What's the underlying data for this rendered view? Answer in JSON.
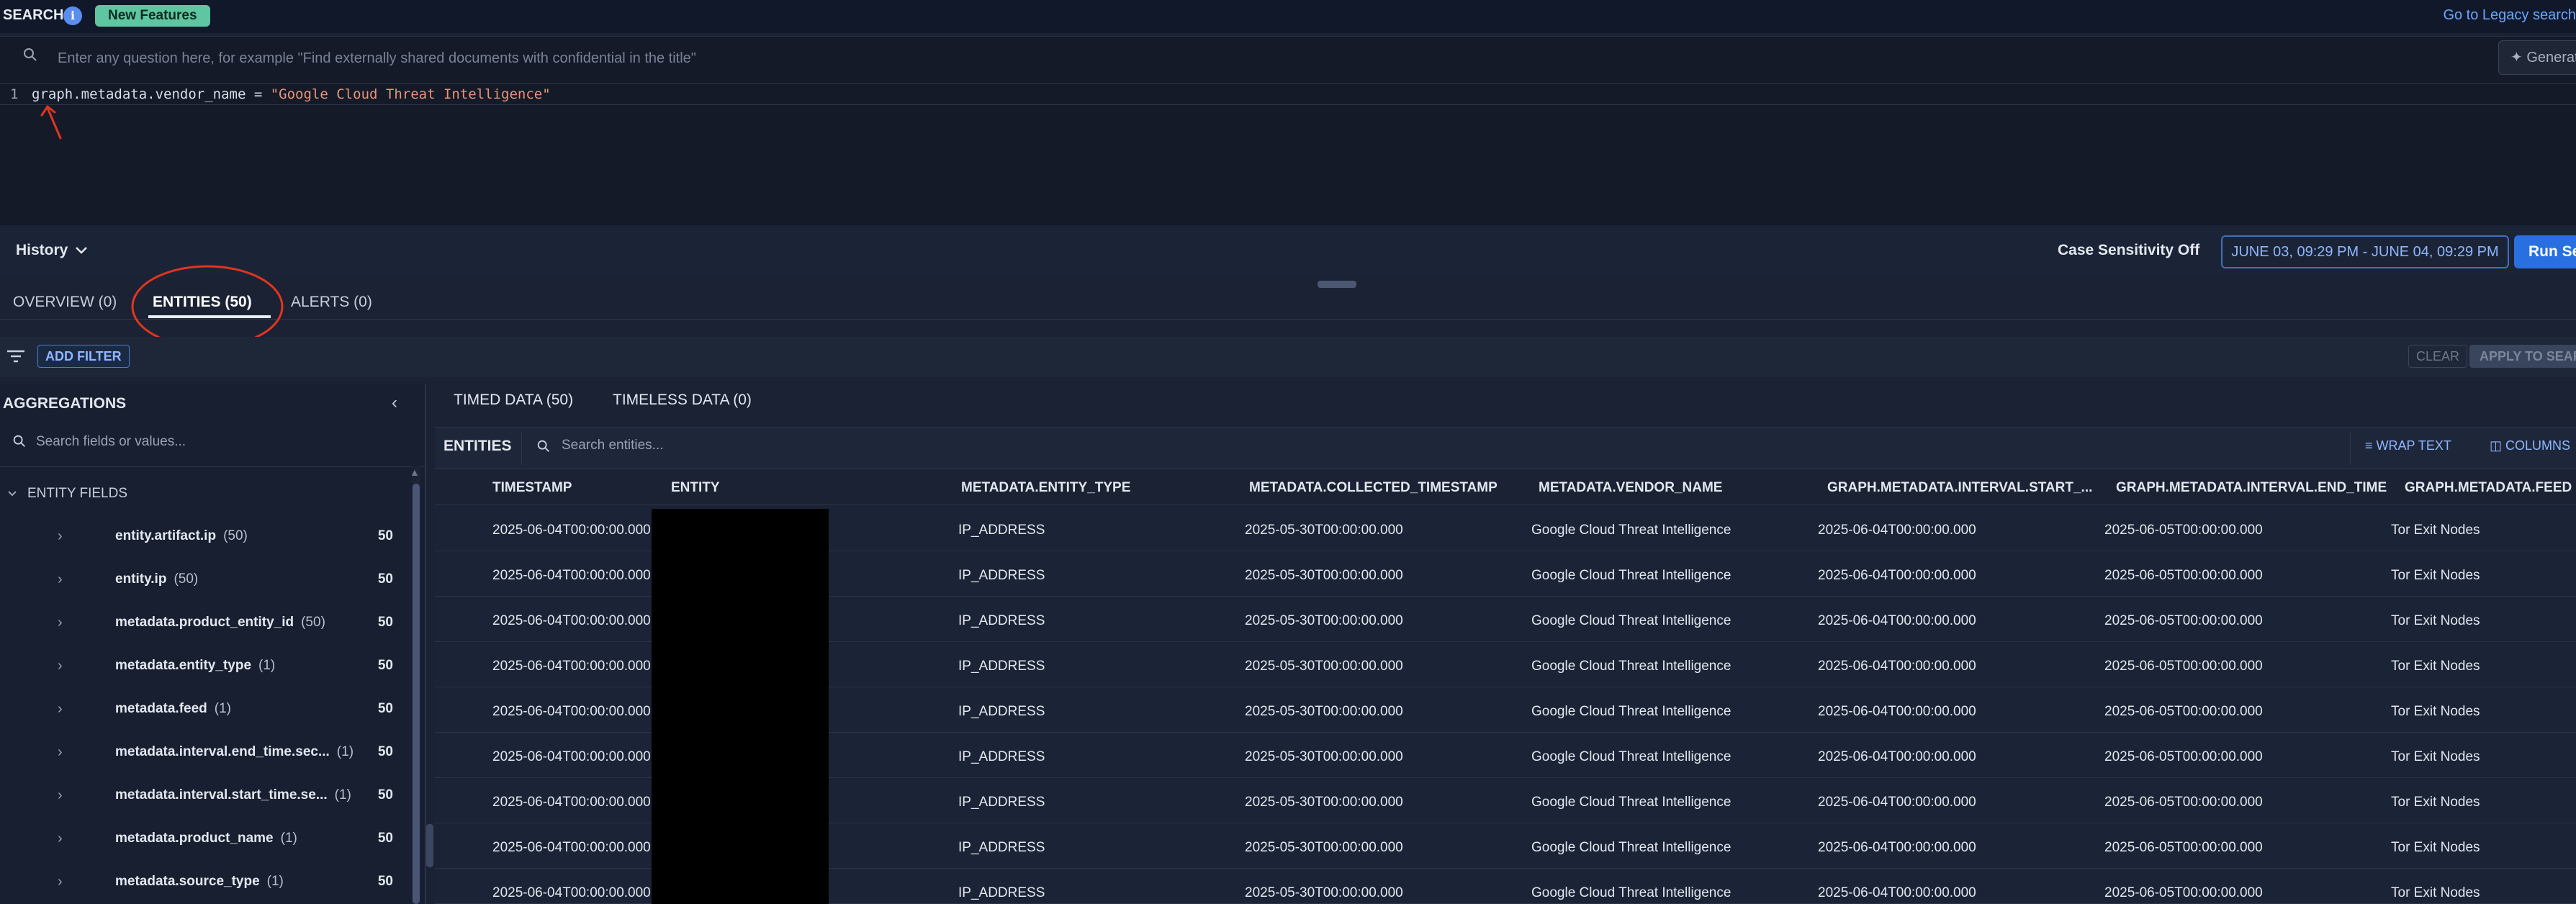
{
  "header": {
    "search_label": "SEARCH",
    "new_features": "New Features",
    "legacy_link": "Go to Legacy search"
  },
  "query": {
    "ask_placeholder": "Enter any question here, for example \"Find externally shared documents with confidential in the title\"",
    "generate_label": "Generate",
    "line_number": "1",
    "code_field": "graph.metadata.vendor_name = ",
    "code_value": "\"Google Cloud Threat Intelligence\""
  },
  "controls": {
    "history": "History",
    "case_sensitivity": "Case Sensitivity Off",
    "date_range": "JUNE 03, 09:29 PM - JUNE 04, 09:29 PM",
    "run_search": "Run Search"
  },
  "tabs": [
    {
      "label": "OVERVIEW (0)"
    },
    {
      "label": "ENTITIES (50)"
    },
    {
      "label": "ALERTS (0)"
    }
  ],
  "filters": {
    "add_filter": "ADD FILTER",
    "clear": "CLEAR",
    "apply": "APPLY TO SEARCH"
  },
  "aggregations": {
    "title": "AGGREGATIONS",
    "search_placeholder": "Search fields or values...",
    "section_label": "ENTITY FIELDS",
    "fields": [
      {
        "name": "entity.artifact.ip",
        "count": "(50)",
        "total": "50"
      },
      {
        "name": "entity.ip",
        "count": "(50)",
        "total": "50"
      },
      {
        "name": "metadata.product_entity_id",
        "count": "(50)",
        "total": "50"
      },
      {
        "name": "metadata.entity_type",
        "count": "(1)",
        "total": "50"
      },
      {
        "name": "metadata.feed",
        "count": "(1)",
        "total": "50"
      },
      {
        "name": "metadata.interval.end_time.sec...",
        "count": "(1)",
        "total": "50"
      },
      {
        "name": "metadata.interval.start_time.se...",
        "count": "(1)",
        "total": "50"
      },
      {
        "name": "metadata.product_name",
        "count": "(1)",
        "total": "50"
      },
      {
        "name": "metadata.source_type",
        "count": "(1)",
        "total": "50"
      }
    ]
  },
  "results": {
    "tabs": [
      {
        "label": "TIMED DATA (50)"
      },
      {
        "label": "TIMELESS DATA (0)"
      }
    ],
    "toolbar_label": "ENTITIES",
    "search_placeholder": "Search entities...",
    "wrap_text": "WRAP TEXT",
    "columns": "COLUMNS",
    "headers": [
      "TIMESTAMP",
      "ENTITY",
      "METADATA.ENTITY_TYPE",
      "METADATA.COLLECTED_TIMESTAMP",
      "METADATA.VENDOR_NAME",
      "GRAPH.METADATA.INTERVAL.START_...",
      "GRAPH.METADATA.INTERVAL.END_TIME",
      "GRAPH.METADATA.FEED"
    ],
    "rows": [
      {
        "timestamp": "2025-06-04T00:00:00.000",
        "entity_type": "IP_ADDRESS",
        "collected": "2025-05-30T00:00:00.000",
        "vendor": "Google Cloud Threat Intelligence",
        "start": "2025-06-04T00:00:00.000",
        "end": "2025-06-05T00:00:00.000",
        "feed": "Tor Exit Nodes"
      },
      {
        "timestamp": "2025-06-04T00:00:00.000",
        "entity_type": "IP_ADDRESS",
        "collected": "2025-05-30T00:00:00.000",
        "vendor": "Google Cloud Threat Intelligence",
        "start": "2025-06-04T00:00:00.000",
        "end": "2025-06-05T00:00:00.000",
        "feed": "Tor Exit Nodes"
      },
      {
        "timestamp": "2025-06-04T00:00:00.000",
        "entity_type": "IP_ADDRESS",
        "collected": "2025-05-30T00:00:00.000",
        "vendor": "Google Cloud Threat Intelligence",
        "start": "2025-06-04T00:00:00.000",
        "end": "2025-06-05T00:00:00.000",
        "feed": "Tor Exit Nodes"
      },
      {
        "timestamp": "2025-06-04T00:00:00.000",
        "entity_type": "IP_ADDRESS",
        "collected": "2025-05-30T00:00:00.000",
        "vendor": "Google Cloud Threat Intelligence",
        "start": "2025-06-04T00:00:00.000",
        "end": "2025-06-05T00:00:00.000",
        "feed": "Tor Exit Nodes"
      },
      {
        "timestamp": "2025-06-04T00:00:00.000",
        "entity_type": "IP_ADDRESS",
        "collected": "2025-05-30T00:00:00.000",
        "vendor": "Google Cloud Threat Intelligence",
        "start": "2025-06-04T00:00:00.000",
        "end": "2025-06-05T00:00:00.000",
        "feed": "Tor Exit Nodes"
      },
      {
        "timestamp": "2025-06-04T00:00:00.000",
        "entity_type": "IP_ADDRESS",
        "collected": "2025-05-30T00:00:00.000",
        "vendor": "Google Cloud Threat Intelligence",
        "start": "2025-06-04T00:00:00.000",
        "end": "2025-06-05T00:00:00.000",
        "feed": "Tor Exit Nodes"
      },
      {
        "timestamp": "2025-06-04T00:00:00.000",
        "entity_type": "IP_ADDRESS",
        "collected": "2025-05-30T00:00:00.000",
        "vendor": "Google Cloud Threat Intelligence",
        "start": "2025-06-04T00:00:00.000",
        "end": "2025-06-05T00:00:00.000",
        "feed": "Tor Exit Nodes"
      },
      {
        "timestamp": "2025-06-04T00:00:00.000",
        "entity_type": "IP_ADDRESS",
        "collected": "2025-05-30T00:00:00.000",
        "vendor": "Google Cloud Threat Intelligence",
        "start": "2025-06-04T00:00:00.000",
        "end": "2025-06-05T00:00:00.000",
        "feed": "Tor Exit Nodes"
      },
      {
        "timestamp": "2025-06-04T00:00:00.000",
        "entity_type": "IP_ADDRESS",
        "collected": "2025-05-30T00:00:00.000",
        "vendor": "Google Cloud Threat Intelligence",
        "start": "2025-06-04T00:00:00.000",
        "end": "2025-06-05T00:00:00.000",
        "feed": "Tor Exit Nodes"
      }
    ]
  },
  "colors": {
    "accent": "#2a6fe0",
    "link": "#6aa6ff",
    "badge": "#5ec7a1",
    "annotation": "#e0351f"
  },
  "icons": [
    "info-icon",
    "search-icon",
    "magic-wand-icon",
    "chevron-down-icon",
    "filter-icon",
    "chevron-left-icon",
    "chevron-right-icon",
    "wrap-text-icon",
    "columns-icon"
  ]
}
